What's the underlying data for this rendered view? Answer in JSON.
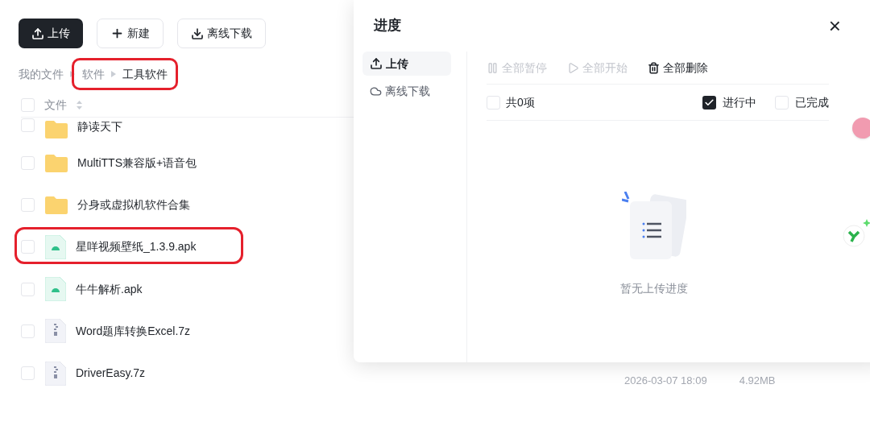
{
  "toolbar": [
    {
      "kind": "upload",
      "label": "上传",
      "primary": true
    },
    {
      "kind": "new",
      "label": "新建",
      "primary": false
    },
    {
      "kind": "download",
      "label": "离线下载",
      "primary": false
    }
  ],
  "breadcrumb": [
    {
      "label": "我的文件",
      "current": false,
      "highlighted": false
    },
    {
      "label": "软件",
      "current": false,
      "highlighted": true
    },
    {
      "label": "工具软件",
      "current": true,
      "highlighted": true
    }
  ],
  "table": {
    "header": "文件",
    "rows": [
      {
        "kind": "folder",
        "name": "静读天下",
        "highlighted": false,
        "checked": false
      },
      {
        "kind": "folder",
        "name": "MultiTTS兼容版+语音包",
        "highlighted": false,
        "checked": false
      },
      {
        "kind": "folder",
        "name": "分身或虚拟机软件合集",
        "highlighted": false,
        "checked": false
      },
      {
        "kind": "apk",
        "name": "星咩视频壁纸_1.3.9.apk",
        "highlighted": true,
        "checked": false
      },
      {
        "kind": "apk",
        "name": "牛牛解析.apk",
        "highlighted": false,
        "checked": false
      },
      {
        "kind": "archive",
        "name": "Word题库转换Excel.7z",
        "highlighted": false,
        "checked": false
      },
      {
        "kind": "archive",
        "name": "DriverEasy.7z",
        "highlighted": false,
        "checked": false,
        "date": "2026-03-07 18:09",
        "size": "4.92MB"
      }
    ]
  },
  "panel": {
    "title": "进度",
    "close": "×",
    "tabs": [
      {
        "kind": "upload",
        "label": "上传",
        "selected": true
      },
      {
        "kind": "cloud",
        "label": "离线下载",
        "selected": false
      }
    ],
    "actions": [
      {
        "kind": "pause",
        "label": "全部暂停",
        "disabled": true
      },
      {
        "kind": "play",
        "label": "全部开始",
        "disabled": true
      },
      {
        "kind": "delete",
        "label": "全部删除",
        "disabled": false
      }
    ],
    "count": {
      "label": "共0项",
      "checked": false
    },
    "filters": [
      {
        "label": "进行中",
        "checked": true
      },
      {
        "label": "已完成",
        "checked": false
      }
    ],
    "empty": "暂无上传进度"
  }
}
